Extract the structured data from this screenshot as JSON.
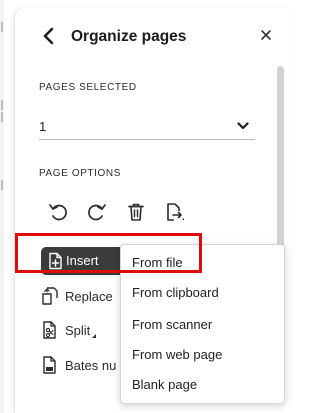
{
  "header": {
    "title": "Organize pages"
  },
  "pages_selected": {
    "label": "PAGES SELECTED",
    "value": "1"
  },
  "page_options": {
    "label": "PAGE OPTIONS"
  },
  "actions": {
    "insert": "Insert",
    "replace": "Replace",
    "split": "Split",
    "bates": "Bates nu"
  },
  "insert_menu": {
    "items": [
      "From file",
      "From clipboard",
      "From scanner",
      "From web page",
      "Blank page"
    ]
  },
  "colors": {
    "highlight": "#e00b0b",
    "insert_button_bg": "#3b3b3b"
  }
}
